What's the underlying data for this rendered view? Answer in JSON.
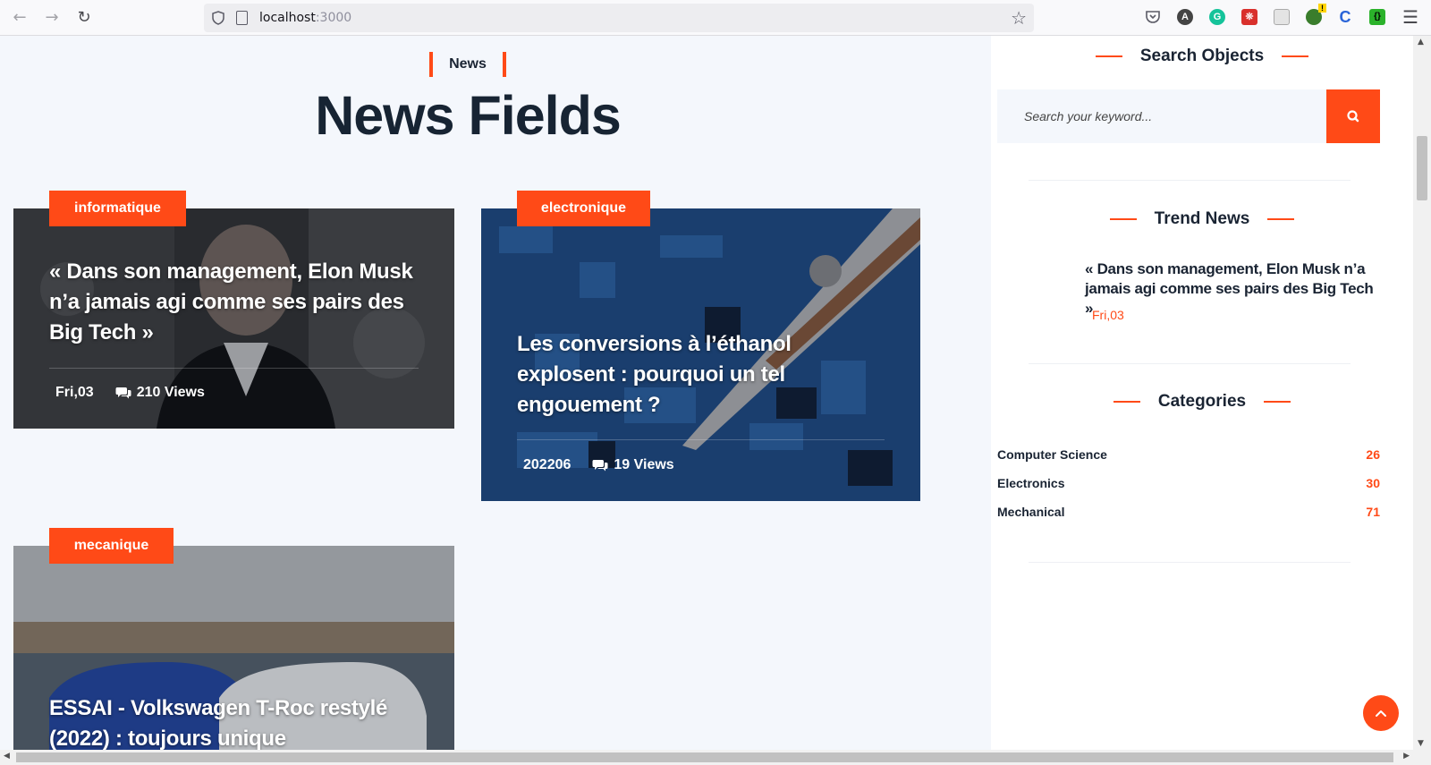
{
  "browser": {
    "url_host": "localhost",
    "url_port": ":3000",
    "icons": [
      "back-icon",
      "forward-icon",
      "reload-icon",
      "shield-icon",
      "page-icon",
      "bookmark-star-icon",
      "pocket-icon",
      "account-icon",
      "grammarly-icon",
      "pdf-icon",
      "reader-icon",
      "extension-alert-icon",
      "c-extension-icon",
      "json-extension-icon",
      "menu-icon"
    ]
  },
  "main": {
    "section_tag": "News",
    "section_title": "News Fields",
    "cards": [
      {
        "category": "informatique",
        "title": "« Dans son management, Elon Musk n’a jamais agi comme ses pairs des Big Tech »",
        "date": "Fri,03",
        "views": "210 Views"
      },
      {
        "category": "electronique",
        "title": "Les conversions à l’éthanol explosent : pourquoi un tel engouement ?",
        "date": "202206",
        "views": "19 Views"
      },
      {
        "category": "mecanique",
        "title": "ESSAI - Volkswagen T-Roc restylé (2022) : toujours unique"
      }
    ]
  },
  "sidebar": {
    "search_title": "Search Objects",
    "search_placeholder": "Search your keyword...",
    "trend_title": "Trend News",
    "trend_item": {
      "title": "« Dans son management, Elon Musk n’a jamais agi comme ses pairs des Big Tech »",
      "date": "Fri,03"
    },
    "categories_title": "Categories",
    "categories": [
      {
        "name": "Computer Science",
        "count": "26"
      },
      {
        "name": "Electronics",
        "count": "30"
      },
      {
        "name": "Mechanical",
        "count": "71"
      }
    ]
  },
  "colors": {
    "accent": "#ff4a17",
    "heading": "#172433",
    "background": "#f4f7fc"
  }
}
